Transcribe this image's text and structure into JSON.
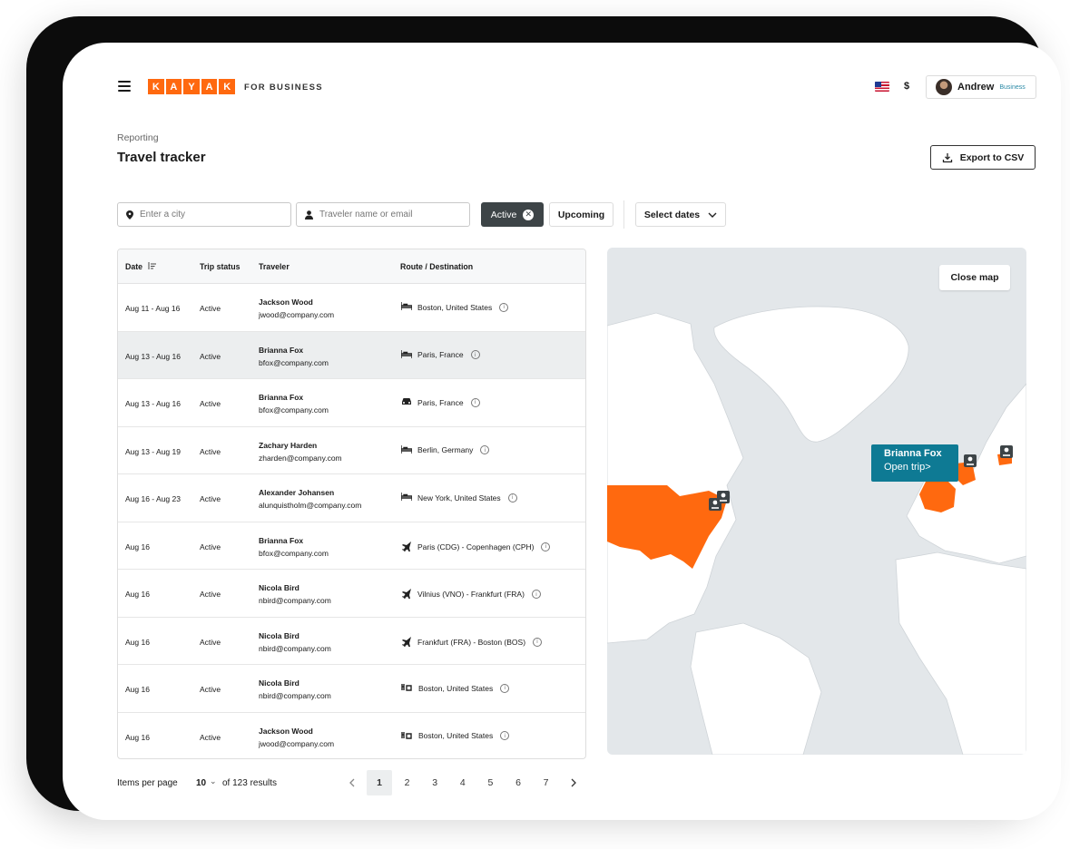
{
  "header": {
    "logo_letters": [
      "K",
      "A",
      "Y",
      "A",
      "K"
    ],
    "logo_sub": "FOR BUSINESS",
    "currency": "$",
    "user_name": "Andrew",
    "user_badge": "Business",
    "brand_color": "#ff690f"
  },
  "page": {
    "breadcrumb": "Reporting",
    "title": "Travel tracker",
    "export_label": "Export to CSV"
  },
  "filters": {
    "city_placeholder": "Enter a city",
    "traveler_placeholder": "Traveler name or email",
    "active_chip": "Active",
    "upcoming_chip": "Upcoming",
    "dates_label": "Select dates"
  },
  "table": {
    "columns": [
      "Date",
      "Trip status",
      "Traveler",
      "Route / Destination"
    ],
    "rows": [
      {
        "date": "Aug 11 - Aug 16",
        "status": "Active",
        "name": "Jackson Wood",
        "email": "jwood@company.com",
        "icon": "hotel-icon",
        "route": "Boston, United States"
      },
      {
        "date": "Aug 13 - Aug 16",
        "status": "Active",
        "name": "Brianna Fox",
        "email": "bfox@company.com",
        "icon": "hotel-icon",
        "route": "Paris, France",
        "selected": true
      },
      {
        "date": "Aug 13 - Aug 16",
        "status": "Active",
        "name": "Brianna Fox",
        "email": "bfox@company.com",
        "icon": "car-icon",
        "route": "Paris, France"
      },
      {
        "date": "Aug 13 - Aug 19",
        "status": "Active",
        "name": "Zachary Harden",
        "email": "zharden@company.com",
        "icon": "hotel-icon",
        "route": "Berlin, Germany"
      },
      {
        "date": "Aug 16 - Aug 23",
        "status": "Active",
        "name": "Alexander Johansen",
        "email": "alunquistholm@company.com",
        "icon": "hotel-icon",
        "route": "New York, United States"
      },
      {
        "date": "Aug 16",
        "status": "Active",
        "name": "Brianna Fox",
        "email": "bfox@company.com",
        "icon": "flight-icon",
        "route": "Paris (CDG) - Copenhagen (CPH)"
      },
      {
        "date": "Aug 16",
        "status": "Active",
        "name": "Nicola Bird",
        "email": "nbird@company.com",
        "icon": "flight-icon",
        "route": "Vilnius (VNO) - Frankfurt (FRA)"
      },
      {
        "date": "Aug 16",
        "status": "Active",
        "name": "Nicola Bird",
        "email": "nbird@company.com",
        "icon": "flight-icon",
        "route": "Frankfurt (FRA)  - Boston (BOS)"
      },
      {
        "date": "Aug 16",
        "status": "Active",
        "name": "Nicola Bird",
        "email": "nbird@company.com",
        "icon": "restaurant-icon",
        "route": "Boston, United States"
      },
      {
        "date": "Aug 16",
        "status": "Active",
        "name": "Jackson Wood",
        "email": "jwood@company.com",
        "icon": "restaurant-icon",
        "route": "Boston, United States"
      }
    ]
  },
  "pagination": {
    "label": "Items per page",
    "size": "10",
    "of_results": "of 123 results",
    "pages": [
      "1",
      "2",
      "3",
      "4",
      "5",
      "6",
      "7"
    ],
    "current": "1"
  },
  "map": {
    "close_label": "Close map",
    "tooltip_name": "Brianna Fox",
    "tooltip_link": "Open trip>",
    "highlight_color": "#ff690f",
    "tooltip_color": "#0e7a94"
  }
}
